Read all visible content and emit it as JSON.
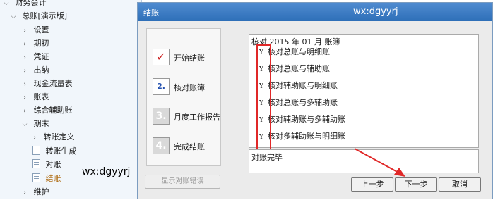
{
  "sidebar": {
    "root": "财务会计",
    "module": "总账[演示版]",
    "items": [
      {
        "label": "设置",
        "state": "collapsed"
      },
      {
        "label": "期初",
        "state": "collapsed"
      },
      {
        "label": "凭证",
        "state": "collapsed"
      },
      {
        "label": "出纳",
        "state": "collapsed"
      },
      {
        "label": "现金流量表",
        "state": "collapsed"
      },
      {
        "label": "账表",
        "state": "collapsed"
      },
      {
        "label": "综合辅助账",
        "state": "collapsed"
      },
      {
        "label": "期末",
        "state": "expanded"
      },
      {
        "label": "转账定义",
        "state": "collapsed"
      },
      {
        "label": "转账生成",
        "state": "leaf"
      },
      {
        "label": "对账",
        "state": "leaf"
      },
      {
        "label": "结账",
        "state": "leaf-active"
      },
      {
        "label": "维护",
        "state": "collapsed"
      }
    ],
    "watermark": "wx:dgyyrj"
  },
  "dialog": {
    "title": "结账",
    "watermark": "wx:dgyyrj",
    "steps": [
      {
        "icon": "checkmark-icon",
        "glyph": "✓",
        "label": "开始结账"
      },
      {
        "icon": "step-2-icon",
        "glyph": "2.",
        "label": "核对账簿"
      },
      {
        "icon": "step-3-icon",
        "glyph": "3.",
        "label": "月度工作报告"
      },
      {
        "icon": "step-4-icon",
        "glyph": "4.",
        "label": "完成结账"
      }
    ],
    "show_errors_label": "显示对账错误",
    "heading": "核对 2015 年 01 月 账簿",
    "checks": [
      {
        "mark": "Y",
        "text": "核对总账与明细账"
      },
      {
        "mark": "Y",
        "text": "核对总账与辅助账"
      },
      {
        "mark": "Y",
        "text": "核对辅助账与明细账"
      },
      {
        "mark": "Y",
        "text": "核对总账与多辅助账"
      },
      {
        "mark": "Y",
        "text": "核对辅助账与多辅助账"
      },
      {
        "mark": "Y",
        "text": "核对多辅助账与明细账"
      }
    ],
    "result": "对账完毕",
    "buttons": {
      "prev": "上一步",
      "next": "下一步",
      "cancel": "取消"
    },
    "highlight_color": "#e02828"
  }
}
